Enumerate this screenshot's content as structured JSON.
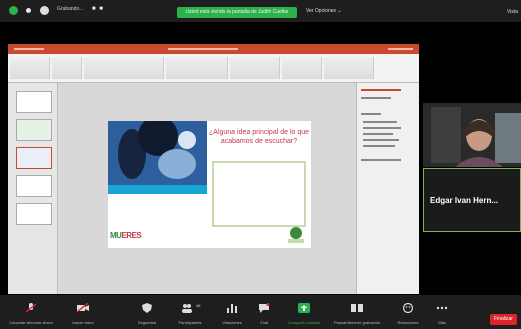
{
  "window": {
    "recording_label": "Grabando...",
    "dots": "■ ■",
    "banner": "Usted está viendo la pantalla de Judith Cuellar",
    "view_options": "Ver Opciones ⌄",
    "view": "Vista"
  },
  "slide": {
    "question": "¿Alguna idea principal de lo que acabamos de escuchar?",
    "logo_prefix": "MU",
    "logo_suffix": "ERES"
  },
  "participants": {
    "active_name": "Edgar Ivan Hern..."
  },
  "toolbar": [
    {
      "label": "Cancelar silenciar ahora",
      "icon": "microphone-icon"
    },
    {
      "label": "Iniciar video",
      "icon": "video-camera-icon"
    },
    {
      "label": "Seguridad",
      "icon": "shield-icon"
    },
    {
      "label": "Participantes",
      "icon": "participants-icon",
      "count": "46"
    },
    {
      "label": "Votaciones",
      "icon": "polls-icon"
    },
    {
      "label": "Chat",
      "icon": "chat-icon"
    },
    {
      "label": "Compartir pantalla",
      "icon": "share-screen-icon"
    },
    {
      "label": "Pausar/detener grabación",
      "icon": "record-icon"
    },
    {
      "label": "Reacciones",
      "icon": "reactions-icon"
    },
    {
      "label": "Más",
      "icon": "more-icon"
    }
  ],
  "end_label": "Finalizar",
  "colors": {
    "accent_green": "#2bb24c",
    "end_red": "#e0242e",
    "ppt_orange": "#c94a2f"
  }
}
